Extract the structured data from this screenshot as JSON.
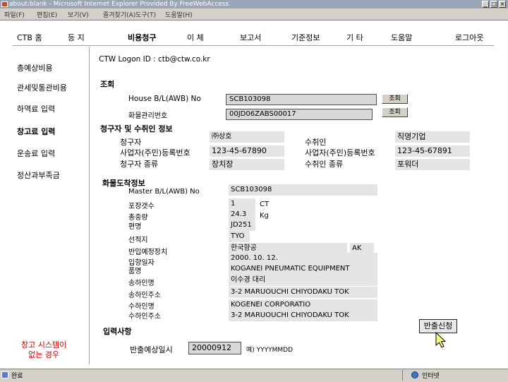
{
  "window": {
    "title": "about:blank - Microsoft Internet Explorer Provided By FreeWebAccess"
  },
  "menubar": [
    "파일(F)",
    "편집(E)",
    "보기(V)",
    "즐겨찾기(A)",
    "도구(T)",
    "도움말(H)"
  ],
  "nav": {
    "items": [
      "CTB 홈",
      "등 지",
      "비용청구",
      "이 체",
      "보고서",
      "기준정보",
      "기 타",
      "도움말",
      "로그아웃"
    ]
  },
  "sidebar": {
    "items": [
      "총예상비용",
      "관세및통관비용",
      "하역료 입력",
      "창고료 입력",
      "운송료 입력",
      "정산과부족금"
    ],
    "footer_line1": "창고 시스템이",
    "footer_line2": "없는 경우"
  },
  "logon": {
    "text": "CTW Logon ID : ctb@ctw.co.kr"
  },
  "search": {
    "heading": "조회",
    "house_bl_label": "House B/L(AWB) No",
    "house_bl_value": "SCB103098",
    "cargo_no_label": "화물관리번호",
    "cargo_no_value": "00JD06ZABS00017",
    "search_button": "조회"
  },
  "parties": {
    "heading": "청구자 및 수취인 정보",
    "claimant_label": "청구자",
    "claimant_value": "㈜상호",
    "claimant_reg_label": "사업자(주민)등록번호",
    "claimant_reg_value": "123-45-67890",
    "claimant_type_label": "청구자 종류",
    "claimant_type_value": "장치장",
    "recipient_label": "수취인",
    "recipient_value": "직영기업",
    "recipient_reg_label": "사업자(주민)등록번호",
    "recipient_reg_value": "123-45-67891",
    "recipient_type_label": "수취인 종류",
    "recipient_type_value": "포워더"
  },
  "cargo": {
    "heading": "화물도착정보",
    "master_bl_label": "Master B/L(AWB) No",
    "master_bl_value": "SCB103098",
    "packages_label": "포장갯수",
    "packages_value": "1",
    "packages_unit": "CT",
    "weight_label": "총중량",
    "weight_value": "24.3",
    "weight_unit": "Kg",
    "flight_label": "편명",
    "flight_value": "JD251",
    "origin_label": "선적지",
    "origin_value": "TYO",
    "storage_label": "반입예정장치",
    "storage_value": "한국항공",
    "storage_code": "AK",
    "entry_date_label": "입항일자",
    "entry_date_value": "2000. 10. 12.",
    "item_label": "품명",
    "item_value": "KOGANEI PNEUMATIC EQUIPMENT",
    "shipper_label": "송하인명",
    "shipper_value": "이수경 대리",
    "shipper_addr_label": "송하인주소",
    "shipper_addr_value": "3-2 MARUOUCHI CHIYODAKU TOK",
    "consignee_label": "수하인명",
    "consignee_value": "KOGENEI CORPORATIO",
    "consignee_addr_label": "수하인주소",
    "consignee_addr_value": "3-2 MARUOUCHI CHIYODAKU TOK"
  },
  "input_section": {
    "heading": "입력사항",
    "release_date_label": "반출예상일시",
    "release_date_value": "20000912",
    "release_date_hint": "예) YYYYMMDD",
    "release_button": "반출신청"
  },
  "statusbar": {
    "left": "완료",
    "right": "인터넷"
  }
}
